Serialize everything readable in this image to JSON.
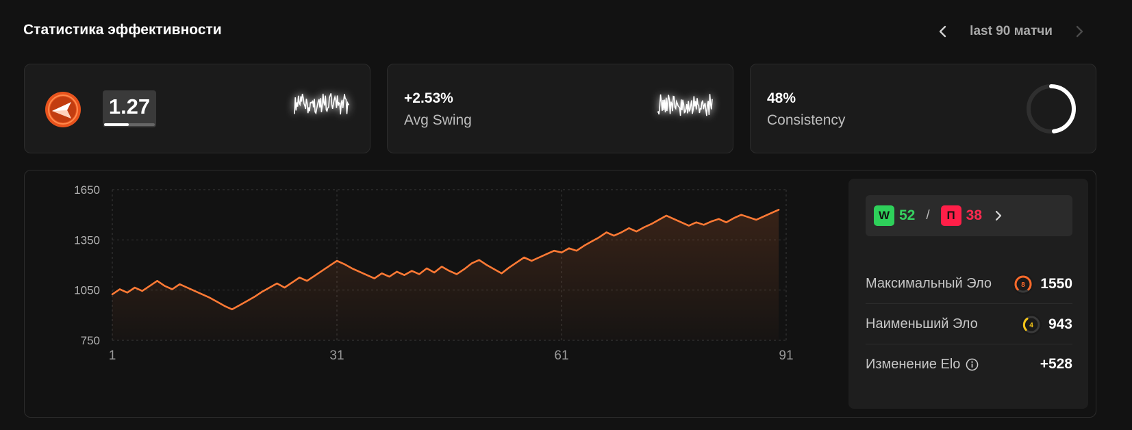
{
  "header": {
    "title": "Статистика эффективности",
    "range_label": "last 90 матчи"
  },
  "cards": {
    "rating": {
      "value": "1.27",
      "bar_fill_fraction": 0.48
    },
    "swing": {
      "value": "+2.53%",
      "label": "Avg Swing"
    },
    "consistency": {
      "value": "48%",
      "label": "Consistency",
      "fraction": 0.48
    }
  },
  "side_panel": {
    "wins_badge": "W",
    "wins": "52",
    "separator": "/",
    "losses_badge": "П",
    "losses": "38",
    "max_elo_label": "Максимальный Эло",
    "max_elo_level": "8",
    "max_elo_value": "1550",
    "min_elo_label": "Наименьший Эло",
    "min_elo_level": "4",
    "min_elo_value": "943",
    "elo_change_label": "Изменение Elo",
    "elo_change_value": "+528"
  },
  "colors": {
    "accent": "#ff7a35",
    "win": "#2ed05a",
    "loss": "#ff1f48",
    "level8": "#ff6a2a",
    "level4": "#f5c518"
  },
  "chart_data": {
    "type": "line",
    "x": [
      1,
      2,
      3,
      4,
      5,
      6,
      7,
      8,
      9,
      10,
      11,
      12,
      13,
      14,
      15,
      16,
      17,
      18,
      19,
      20,
      21,
      22,
      23,
      24,
      25,
      26,
      27,
      28,
      29,
      30,
      31,
      32,
      33,
      34,
      35,
      36,
      37,
      38,
      39,
      40,
      41,
      42,
      43,
      44,
      45,
      46,
      47,
      48,
      49,
      50,
      51,
      52,
      53,
      54,
      55,
      56,
      57,
      58,
      59,
      60,
      61,
      62,
      63,
      64,
      65,
      66,
      67,
      68,
      69,
      70,
      71,
      72,
      73,
      74,
      75,
      76,
      77,
      78,
      79,
      80,
      81,
      82,
      83,
      84,
      85,
      86,
      87,
      88,
      89,
      90
    ],
    "y": [
      1025,
      1055,
      1035,
      1065,
      1045,
      1075,
      1105,
      1075,
      1055,
      1085,
      1065,
      1045,
      1025,
      1005,
      980,
      955,
      935,
      960,
      985,
      1010,
      1040,
      1065,
      1090,
      1065,
      1095,
      1125,
      1105,
      1135,
      1165,
      1195,
      1225,
      1205,
      1180,
      1160,
      1140,
      1120,
      1150,
      1130,
      1160,
      1140,
      1165,
      1145,
      1180,
      1155,
      1190,
      1165,
      1145,
      1175,
      1210,
      1230,
      1200,
      1175,
      1150,
      1185,
      1215,
      1245,
      1225,
      1245,
      1265,
      1285,
      1275,
      1300,
      1285,
      1315,
      1340,
      1365,
      1395,
      1375,
      1395,
      1420,
      1400,
      1425,
      1445,
      1470,
      1495,
      1475,
      1455,
      1435,
      1455,
      1440,
      1460,
      1475,
      1455,
      1480,
      1500,
      1485,
      1470,
      1490,
      1510,
      1530
    ],
    "xticks": [
      1,
      31,
      61,
      91
    ],
    "xtick_labels": [
      "1",
      "31",
      "61",
      "91"
    ],
    "yticks": [
      750,
      1050,
      1350,
      1650
    ],
    "ytick_labels": [
      "750",
      "1050",
      "1350",
      "1650"
    ],
    "xlim": [
      1,
      91
    ],
    "ylim": [
      750,
      1650
    ],
    "grid": true
  }
}
